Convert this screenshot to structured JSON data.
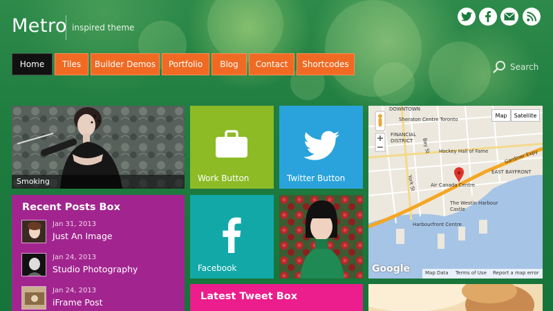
{
  "brand": {
    "name": "Metro",
    "tagline": "inspired theme"
  },
  "social": [
    {
      "icon": "twitter-icon"
    },
    {
      "icon": "facebook-icon"
    },
    {
      "icon": "mail-icon"
    },
    {
      "icon": "rss-icon"
    }
  ],
  "nav": [
    {
      "label": "Home",
      "active": true
    },
    {
      "label": "Tiles"
    },
    {
      "label": "Builder Demos"
    },
    {
      "label": "Portfolio"
    },
    {
      "label": "Blog"
    },
    {
      "label": "Contact"
    },
    {
      "label": "Shortcodes"
    }
  ],
  "search": {
    "placeholder": "Search"
  },
  "tiles": {
    "smoking": {
      "label": "Smoking"
    },
    "work": {
      "label": "Work Button"
    },
    "twitter": {
      "label": "Twitter Button"
    },
    "facebook": {
      "label": "Facebook"
    },
    "latest_tweet": {
      "title": "Latest Tweet Box"
    }
  },
  "recent_posts": {
    "title": "Recent Posts Box",
    "items": [
      {
        "date": "Jan 31, 2013",
        "title": "Just An Image"
      },
      {
        "date": "Jan 24, 2013",
        "title": "Studio Photography"
      },
      {
        "date": "Jan 24, 2013",
        "title": "iFrame Post"
      }
    ]
  },
  "map": {
    "buttons": {
      "map": "Map",
      "satellite": "Satellite"
    },
    "labels": {
      "downtown": "DOWNTOWN",
      "sheraton": "Sheraton Centre Toronto",
      "financial": "FINANCIAL DISTRICT",
      "hockey": "Hockey Hall of Fame",
      "gardiner": "Gardiner Expy",
      "east_bayfront": "EAST BAYFRONT",
      "air_canada": "Air Canada Centre",
      "westin": "The Westin Harbour Castle",
      "harbourfront": "Harbourfront Centre",
      "bay_st": "Bay St",
      "york_st": "York St"
    },
    "footer": {
      "map_data": "Map Data",
      "terms": "Terms of Use",
      "report": "Report a map error"
    },
    "google": "Google"
  },
  "colors": {
    "nav_orange": "#f06a23",
    "tile_green": "#8cbb26",
    "tile_blue": "#2aa3dc",
    "tile_teal": "#12a8a8",
    "tile_purple": "#a2258f",
    "tile_pink": "#ec1d8c"
  }
}
